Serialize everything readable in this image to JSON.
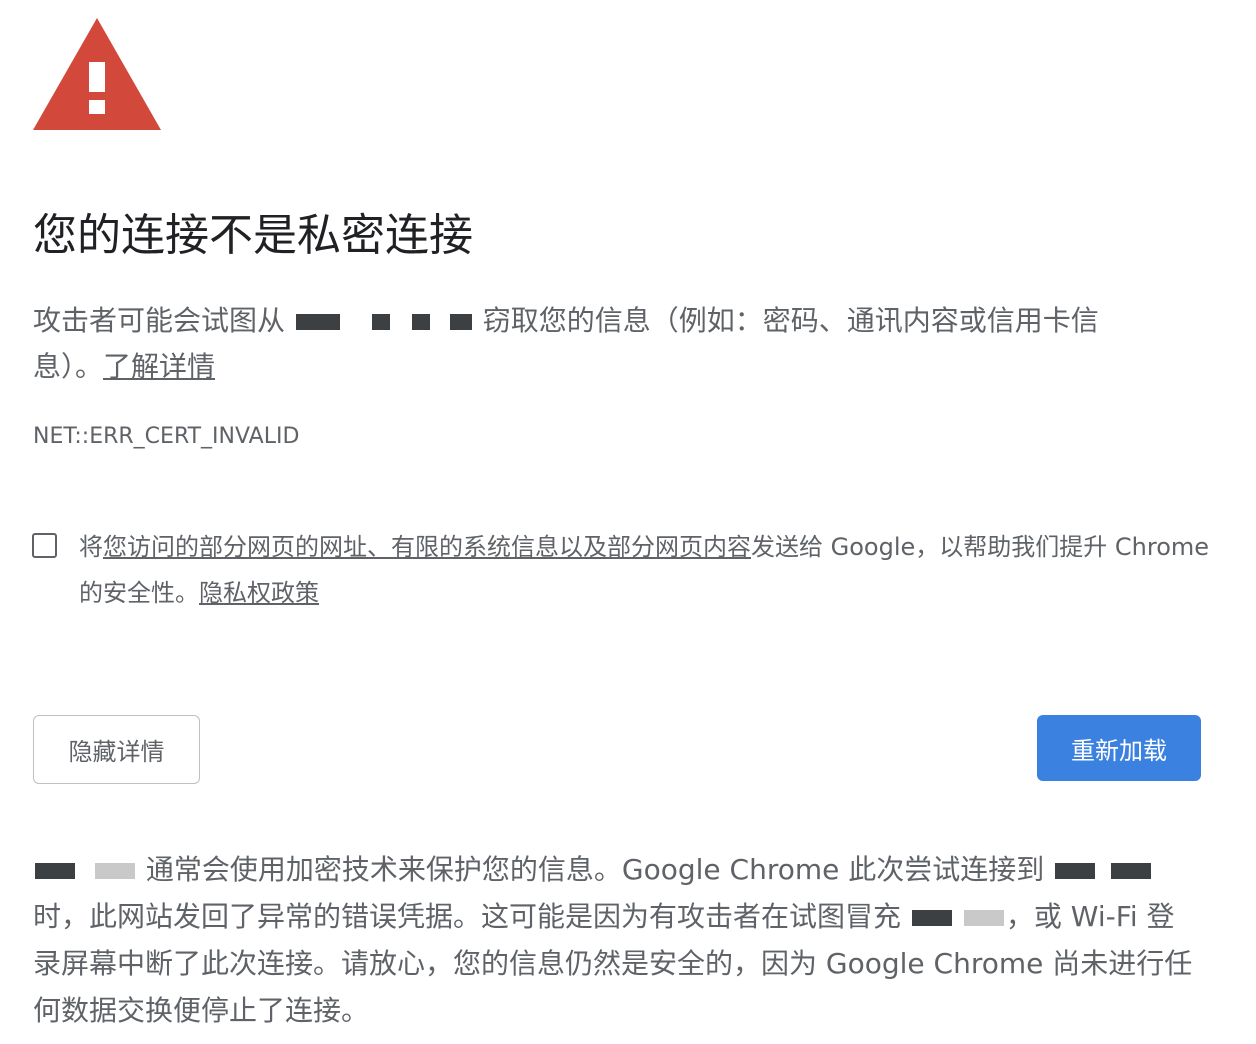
{
  "warning_icon": "warning-triangle-icon",
  "accent_color": "#d2483a",
  "button_color": "#3b82e0",
  "title": "您的连接不是私密连接",
  "main_message": {
    "prefix": "攻击者可能会试图从 ",
    "suffix": " 窃取您的信息（例如：密码、通讯内容或信用卡信息）。",
    "learn_more": "了解详情"
  },
  "error_code": "NET::ERR_CERT_INVALID",
  "optin": {
    "prefix": "将",
    "link": "您访问的部分网页的网址、有限的系统信息以及部分网页内容",
    "middle": "发送给 Google，以帮助我们提升 Chrome 的安全性。",
    "privacy_link": "隐私权政策",
    "checked": false
  },
  "buttons": {
    "hide_details": "隐藏详情",
    "reload": "重新加载"
  },
  "details": {
    "part1": " 通常会使用加密技术来保护您的信息。Google Chrome 此次尝试连接到 ",
    "part2": " 时，此网站发回了异常的错误凭据。这可能是因为有攻击者在试图冒充 ",
    "part3": "，或 Wi-Fi 登录屏幕中断了此次连接。请放心，您的信息仍然是安全的，因为 Google Chrome 尚未进行任何数据交换便停止了连接。"
  }
}
